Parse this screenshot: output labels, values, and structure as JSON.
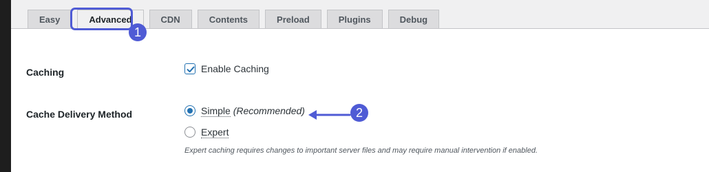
{
  "tabs": [
    {
      "label": "Easy"
    },
    {
      "label": "Advanced"
    },
    {
      "label": "CDN"
    },
    {
      "label": "Contents"
    },
    {
      "label": "Preload"
    },
    {
      "label": "Plugins"
    },
    {
      "label": "Debug"
    }
  ],
  "active_tab": "Advanced",
  "annotations": {
    "step1": "1",
    "step2": "2",
    "color": "#4f5bd5"
  },
  "caching": {
    "label": "Caching",
    "checkbox_label": "Enable Caching",
    "checked": true
  },
  "delivery": {
    "label": "Cache Delivery Method",
    "options": [
      {
        "label": "Simple",
        "suffix": "(Recommended)",
        "selected": true
      },
      {
        "label": "Expert",
        "selected": false
      }
    ],
    "note": "Expert caching requires changes to important server files and may require manual intervention if enabled."
  },
  "colors": {
    "accent": "#2271b1",
    "background": "#f0f0f1"
  }
}
